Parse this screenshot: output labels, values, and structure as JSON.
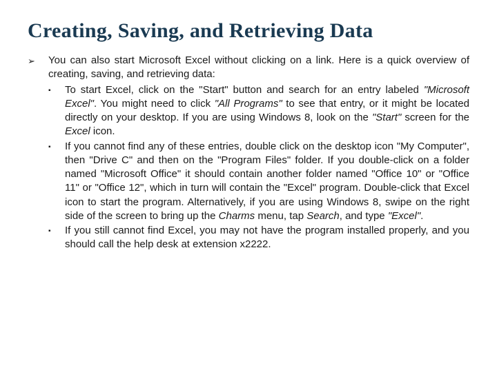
{
  "title": "Creating, Saving, and Retrieving Data",
  "intro": {
    "t1": "You can also start Microsoft Excel without clicking on a link. Here is a quick overview of creating, saving, and retrieving data:"
  },
  "bullet1": {
    "p1": "To start Excel, click on the \"Start\" button and search for an entry labeled ",
    "i1": "\"Microsoft Excel\"",
    "p2": ". You might need to click ",
    "i2": "\"All Programs\"",
    "p3": " to see that entry, or it might be located directly on your desktop. If you are using Windows 8, look on the ",
    "i3": "\"Start\"",
    "p4": " screen for the ",
    "i4": "Excel",
    "p5": " icon."
  },
  "bullet2": {
    "p1": "If you cannot find any of these entries, double click on the desktop icon \"My Computer\", then \"Drive C\" and then on the \"Program Files\" folder. If you double-click on a folder named \"Microsoft Office\" it should contain another folder named \"Office 10\" or \"Office 11\" or \"Office 12\", which in turn will contain the \"Excel\" program. Double-click that Excel icon to start the program. Alternatively, if you are using Windows 8, swipe on the right side of the screen to bring up the ",
    "i1": "Charms",
    "p2": " menu, tap ",
    "i2": "Search",
    "p3": ", and type ",
    "i3": "\"Excel\"",
    "p4": "."
  },
  "bullet3": {
    "t1": "If you still cannot find Excel, you may not have the program installed properly, and you should call the help desk at extension x2222."
  }
}
